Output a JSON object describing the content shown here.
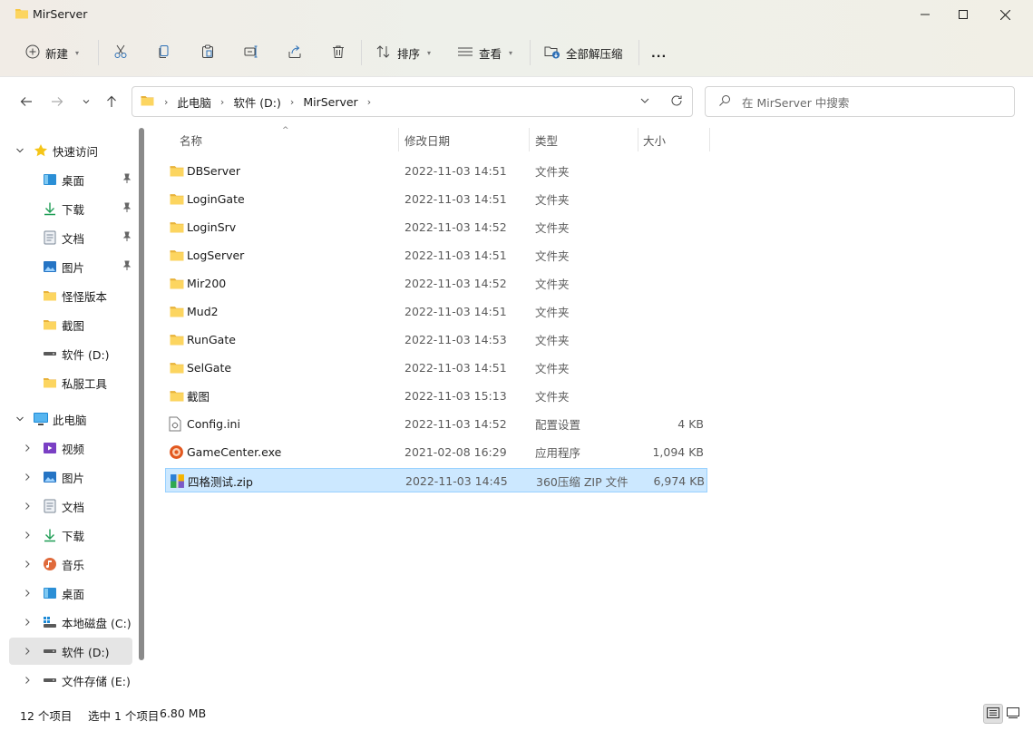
{
  "window": {
    "title": "MirServer"
  },
  "toolbar": {
    "new_label": "新建",
    "sort_label": "排序",
    "view_label": "查看",
    "extract_label": "全部解压缩",
    "more_label": "..."
  },
  "address": {
    "crumbs": [
      "此电脑",
      "软件 (D:)",
      "MirServer"
    ]
  },
  "search": {
    "placeholder": "在 MirServer 中搜索"
  },
  "sidebar": {
    "quick_access": "快速访问",
    "quick_items": [
      "桌面",
      "下载",
      "文档",
      "图片",
      "怪怪版本",
      "截图",
      "软件 (D:)",
      "私服工具"
    ],
    "this_pc": "此电脑",
    "pc_items": [
      "视频",
      "图片",
      "文档",
      "下载",
      "音乐",
      "桌面",
      "本地磁盘 (C:)",
      "软件 (D:)",
      "文件存储 (E:)"
    ]
  },
  "columns": {
    "name": "名称",
    "date": "修改日期",
    "type": "类型",
    "size": "大小"
  },
  "files": [
    {
      "name": "DBServer",
      "date": "2022-11-03 14:51",
      "type": "文件夹",
      "size": "",
      "icon": "folder-icon"
    },
    {
      "name": "LoginGate",
      "date": "2022-11-03 14:51",
      "type": "文件夹",
      "size": "",
      "icon": "folder-icon"
    },
    {
      "name": "LoginSrv",
      "date": "2022-11-03 14:52",
      "type": "文件夹",
      "size": "",
      "icon": "folder-icon"
    },
    {
      "name": "LogServer",
      "date": "2022-11-03 14:51",
      "type": "文件夹",
      "size": "",
      "icon": "folder-icon"
    },
    {
      "name": "Mir200",
      "date": "2022-11-03 14:52",
      "type": "文件夹",
      "size": "",
      "icon": "folder-icon"
    },
    {
      "name": "Mud2",
      "date": "2022-11-03 14:51",
      "type": "文件夹",
      "size": "",
      "icon": "folder-icon"
    },
    {
      "name": "RunGate",
      "date": "2022-11-03 14:53",
      "type": "文件夹",
      "size": "",
      "icon": "folder-icon"
    },
    {
      "name": "SelGate",
      "date": "2022-11-03 14:51",
      "type": "文件夹",
      "size": "",
      "icon": "folder-icon"
    },
    {
      "name": "截图",
      "date": "2022-11-03 15:13",
      "type": "文件夹",
      "size": "",
      "icon": "folder-icon"
    },
    {
      "name": "Config.ini",
      "date": "2022-11-03 14:52",
      "type": "配置设置",
      "size": "4 KB",
      "icon": "ini-file-icon"
    },
    {
      "name": "GameCenter.exe",
      "date": "2021-02-08 16:29",
      "type": "应用程序",
      "size": "1,094 KB",
      "icon": "exe-file-icon"
    },
    {
      "name": "四格测试.zip",
      "date": "2022-11-03 14:45",
      "type": "360压缩 ZIP 文件",
      "size": "6,974 KB",
      "icon": "zip-file-icon"
    }
  ],
  "status": {
    "count": "12 个项目",
    "selection": "选中 1 个项目",
    "selection_size": "6.80 MB"
  },
  "colors": {
    "accent": "#0067c0",
    "selection": "#cce8ff",
    "folder": "#f8c843"
  }
}
